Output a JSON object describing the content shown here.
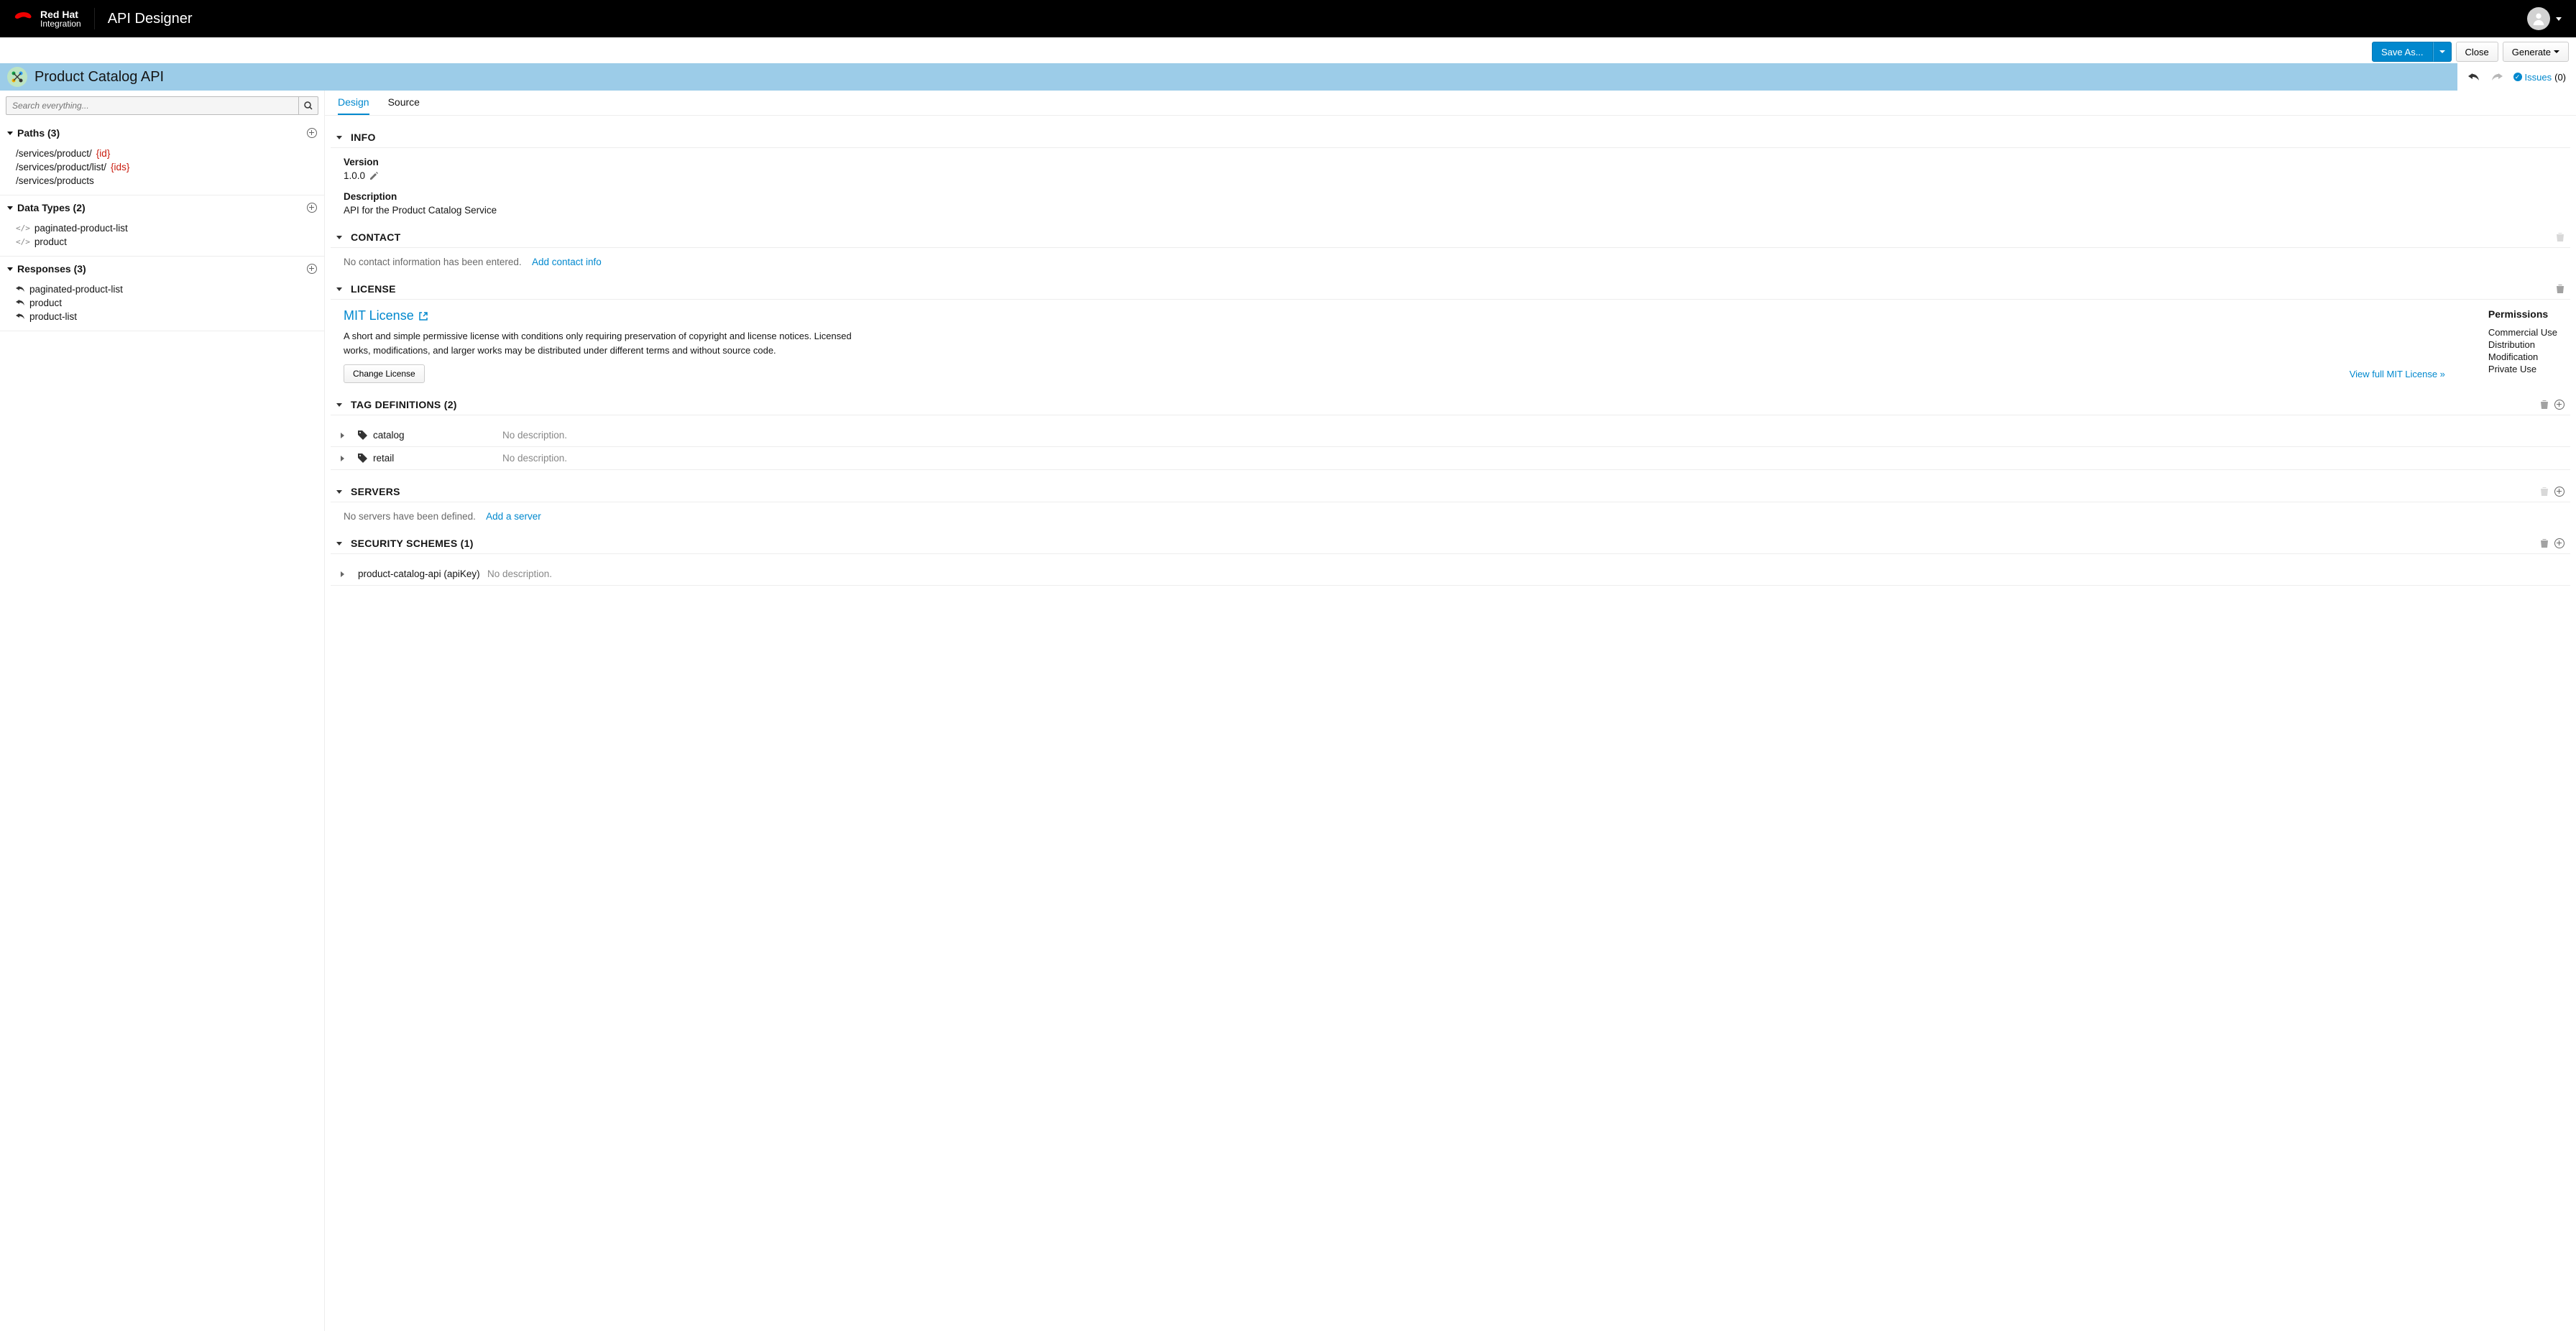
{
  "masthead": {
    "brand_top": "Red Hat",
    "brand_sub": "Integration",
    "app_name": "API Designer"
  },
  "toolbar": {
    "save_as": "Save As...",
    "close": "Close",
    "generate": "Generate"
  },
  "titlebar": {
    "api_title": "Product Catalog API",
    "issues_label": "Issues",
    "issues_count": "(0)"
  },
  "sidebar": {
    "search_placeholder": "Search everything...",
    "paths": {
      "title": "Paths (3)",
      "items": [
        {
          "prefix": "/services/product/",
          "param": "{id}"
        },
        {
          "prefix": "/services/product/list/",
          "param": "{ids}"
        },
        {
          "prefix": "/services/products",
          "param": ""
        }
      ]
    },
    "data_types": {
      "title": "Data Types (2)",
      "items": [
        "paginated-product-list",
        "product"
      ]
    },
    "responses": {
      "title": "Responses (3)",
      "items": [
        "paginated-product-list",
        "product",
        "product-list"
      ]
    }
  },
  "tabs": {
    "design": "Design",
    "source": "Source"
  },
  "sections": {
    "info": {
      "title": "INFO",
      "version_lbl": "Version",
      "version_val": "1.0.0",
      "desc_lbl": "Description",
      "desc_val": "API for the Product Catalog Service"
    },
    "contact": {
      "title": "CONTACT",
      "empty": "No contact information has been entered.",
      "add_link": "Add contact info"
    },
    "license": {
      "title": "LICENSE",
      "name": "MIT License",
      "desc": "A short and simple permissive license with conditions only requiring preservation of copyright and license notices. Licensed works, modifications, and larger works may be distributed under different terms and without source code.",
      "change_btn": "Change License",
      "view_full": "View full MIT License »",
      "perms_title": "Permissions",
      "perms": [
        "Commercial Use",
        "Distribution",
        "Modification",
        "Private Use"
      ]
    },
    "tags": {
      "title": "TAG DEFINITIONS (2)",
      "items": [
        {
          "name": "catalog",
          "desc": "No description."
        },
        {
          "name": "retail",
          "desc": "No description."
        }
      ]
    },
    "servers": {
      "title": "SERVERS",
      "empty": "No servers have been defined.",
      "add_link": "Add a server"
    },
    "security": {
      "title": "SECURITY SCHEMES (1)",
      "items": [
        {
          "name": "product-catalog-api  (apiKey)",
          "desc": "No description."
        }
      ]
    }
  }
}
